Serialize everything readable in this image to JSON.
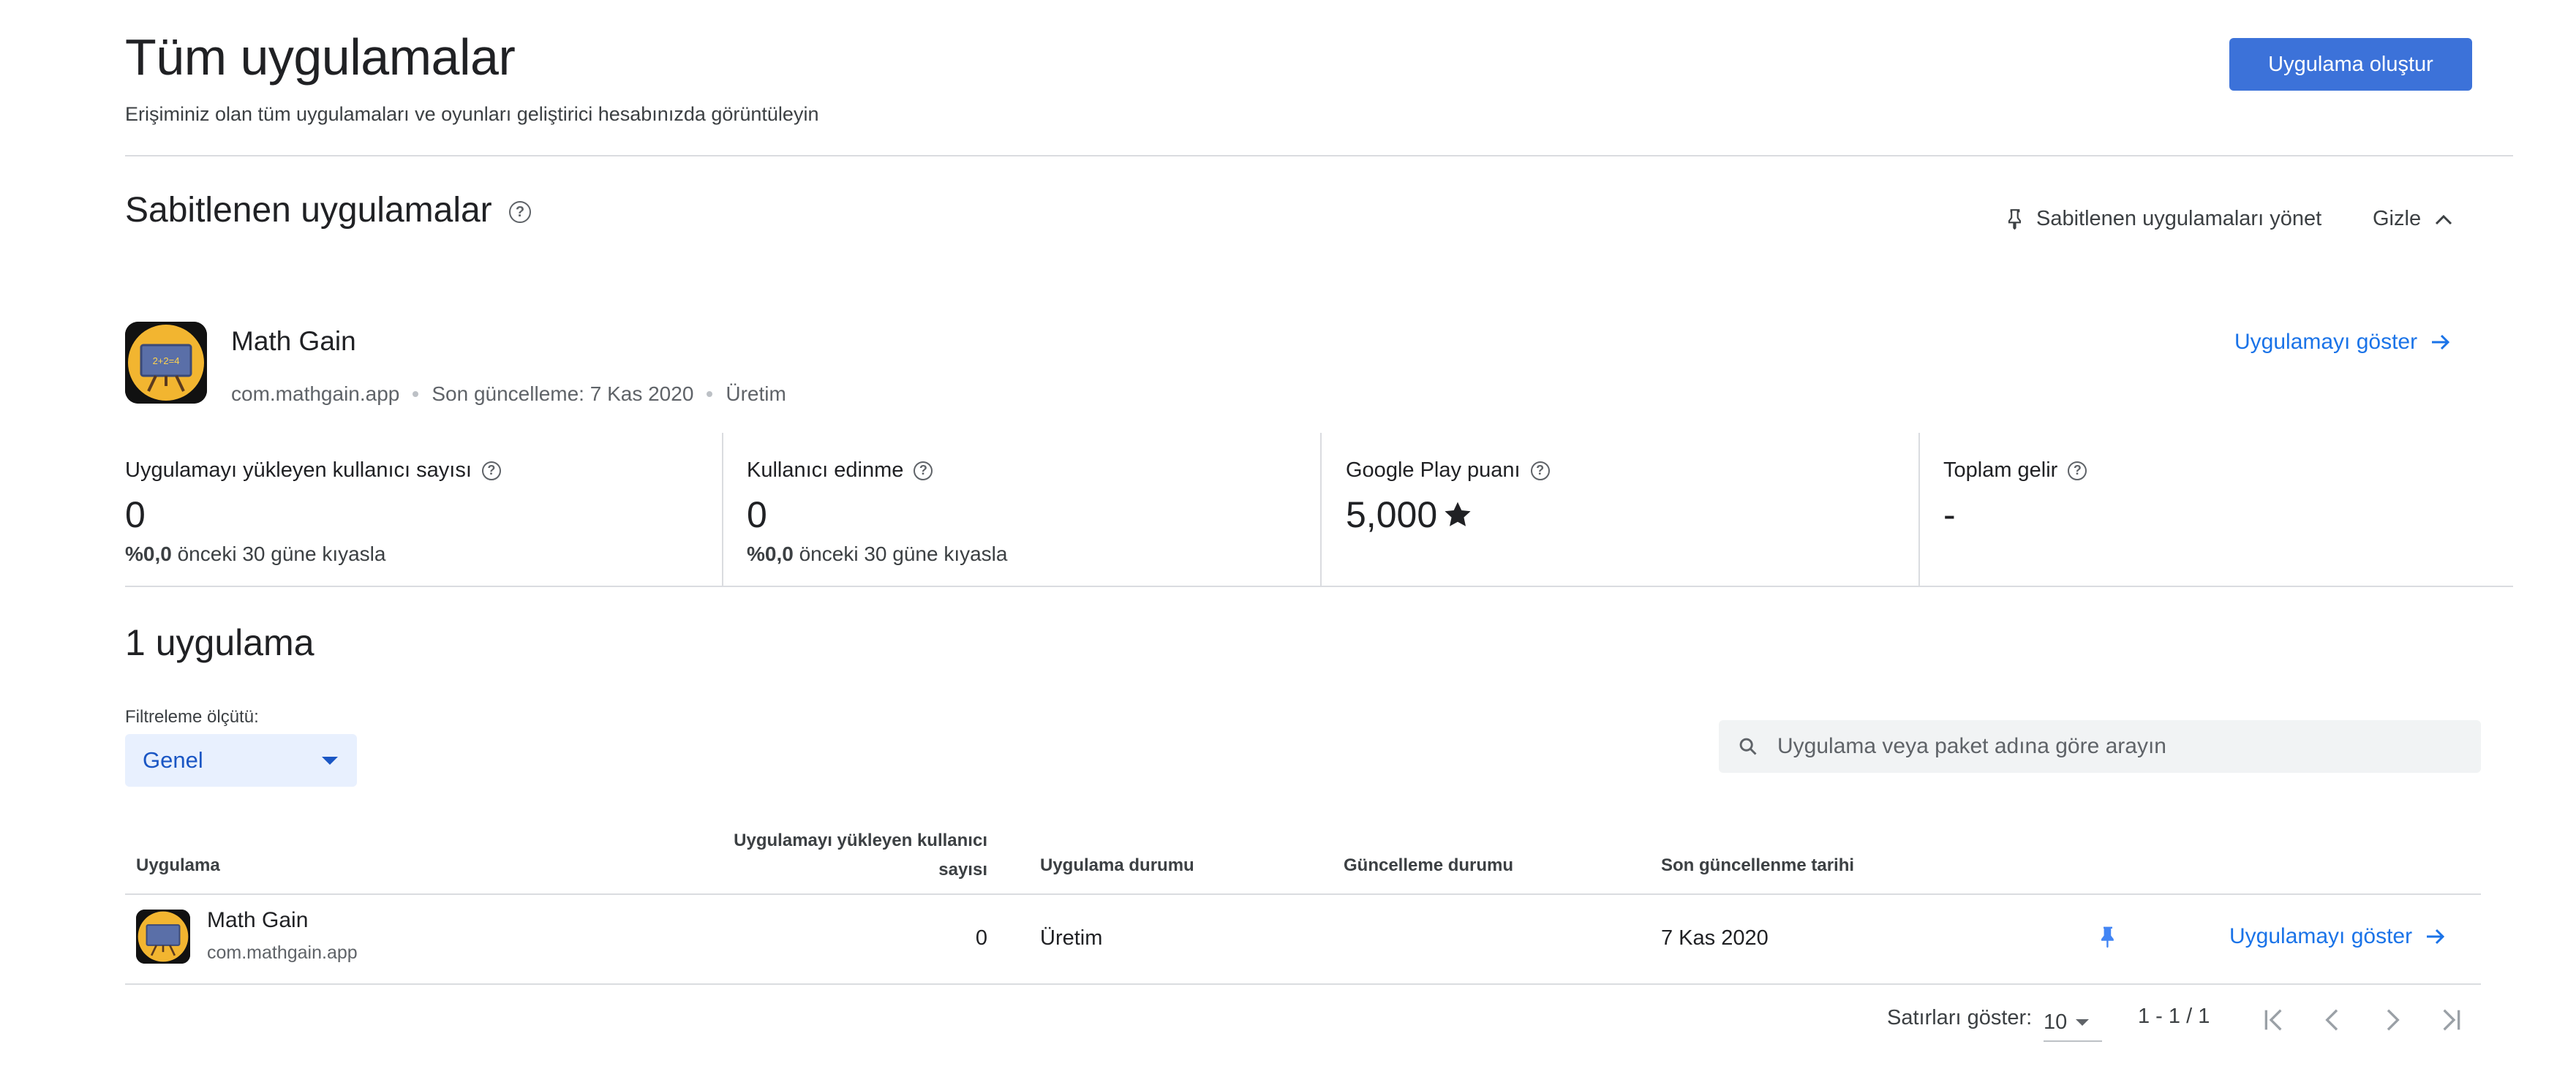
{
  "header": {
    "title": "Tüm uygulamalar",
    "subtitle": "Erişiminiz olan tüm uygulamaları ve oyunları geliştirici hesabınızda görüntüleyin",
    "create_button": "Uygulama oluştur"
  },
  "pinned": {
    "title": "Sabitlenen uygulamalar",
    "manage_label": "Sabitlenen uygulamaları yönet",
    "hide_label": "Gizle",
    "app": {
      "name": "Math Gain",
      "package": "com.mathgain.app",
      "last_update": "Son güncelleme: 7 Kas 2020",
      "status": "Üretim",
      "view_link": "Uygulamayı göster",
      "icon_text": "2+2=4"
    },
    "metrics": [
      {
        "label": "Uygulamayı yükleyen kullanıcı sayısı",
        "value": "0",
        "change": "%0,0",
        "change_suffix": "önceki 30 güne kıyasla"
      },
      {
        "label": "Kullanıcı edinme",
        "value": "0",
        "change": "%0,0",
        "change_suffix": "önceki 30 güne kıyasla"
      },
      {
        "label": "Google Play puanı",
        "value": "5,000"
      },
      {
        "label": "Toplam gelir",
        "value": "-"
      }
    ]
  },
  "list": {
    "count_title": "1 uygulama",
    "filter_label": "Filtreleme ölçütü:",
    "filter_value": "Genel",
    "search_placeholder": "Uygulama veya paket adına göre arayın",
    "columns": {
      "app": "Uygulama",
      "installs_line1": "Uygulamayı yükleyen kullanıcı",
      "installs_line2": "sayısı",
      "app_status": "Uygulama durumu",
      "update_status": "Güncelleme durumu",
      "last_update": "Son güncellenme tarihi"
    },
    "rows": [
      {
        "name": "Math Gain",
        "package": "com.mathgain.app",
        "installs": "0",
        "app_status": "Üretim",
        "update_status": "",
        "last_update": "7 Kas 2020",
        "view_link": "Uygulamayı göster"
      }
    ],
    "pagination": {
      "rows_label": "Satırları göster:",
      "rows_value": "10",
      "range": "1 - 1 / 1"
    }
  },
  "colors": {
    "primary": "#3c72d9",
    "link": "#1a73e8",
    "pin": "#4285f4",
    "icon_bg": "#f2b530",
    "board": "#5a6fa8"
  }
}
